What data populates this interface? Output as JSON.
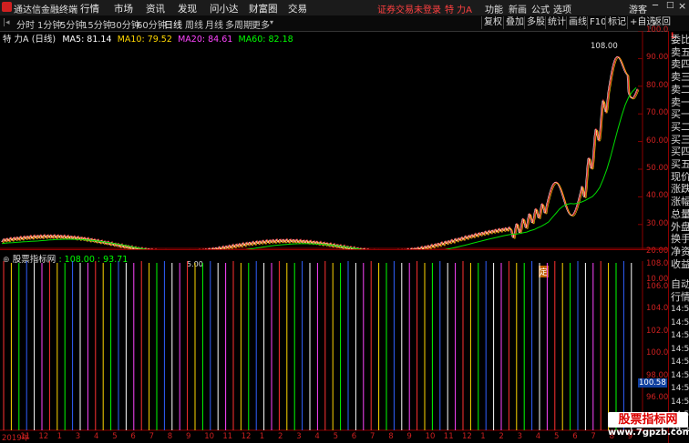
{
  "menubar": {
    "app_title": "通达信金融终端",
    "items": [
      "行情",
      "市场",
      "资讯",
      "发现",
      "问小达",
      "财富圈",
      "交易"
    ],
    "notice": "证券交易未登录",
    "stock_short": "特 力A",
    "right_items": [
      "功能",
      "新画",
      "公式",
      "选项"
    ],
    "user": "游客"
  },
  "periodbar": {
    "tabs": [
      "分时",
      "1分钟",
      "5分钟",
      "15分钟",
      "30分钟",
      "60分钟",
      "日线",
      "周线",
      "月线",
      "多周期",
      "更多"
    ],
    "active_tab": "日线",
    "tools": [
      "复权",
      "叠加",
      "多股",
      "统计",
      "画线",
      "F10",
      "标记",
      "+自选",
      "返回"
    ]
  },
  "main_chart": {
    "title": "特 力A",
    "period_label": "(日线)",
    "ma5_label": "MA5: 81.14",
    "ma10_label": "MA10: 79.52",
    "ma20_label": "MA20: 84.61",
    "ma60_label": "MA60: 82.18",
    "high_label": "108.00",
    "low_label": "5.00",
    "marker_label": "定",
    "y_ticks": [
      "100.0",
      "90.00",
      "80.00",
      "70.00",
      "60.00",
      "50.00",
      "40.00",
      "30.00",
      "20.00",
      "10.00"
    ],
    "colors": {
      "ma5": "#ffffff",
      "ma10": "#ffd700",
      "ma20": "#ff44ff",
      "ma60": "#00ff00"
    }
  },
  "indicator": {
    "name": "股票指标网",
    "values_label": ": 108.00 : 93.71",
    "y_ticks": [
      "108.0",
      "106.0",
      "104.0",
      "102.0",
      "100.0",
      "98.00",
      "96.00"
    ],
    "current_value": "100.58"
  },
  "x_axis": {
    "ticks": [
      "2019年",
      "11",
      "12",
      "1",
      "3",
      "4",
      "5",
      "6",
      "7",
      "8",
      "9",
      "10",
      "11",
      "12",
      "1",
      "2",
      "3",
      "4",
      "5",
      "6",
      "7",
      "8",
      "9",
      "10",
      "11",
      "12",
      "1",
      "2",
      "3",
      "4",
      "5",
      "6",
      "7",
      "8",
      "9"
    ]
  },
  "right_panel": {
    "top_badge": "L",
    "items": [
      "委比",
      "卖五",
      "卖四",
      "卖三",
      "卖二",
      "卖一",
      "买一",
      "买二",
      "买三",
      "买四",
      "买五",
      "现价",
      "涨跌",
      "涨幅",
      "总量",
      "外盘",
      "换手",
      "净资",
      "收益"
    ],
    "bottom_items": [
      "自动",
      "行情"
    ],
    "times": [
      "14:55",
      "14:55",
      "14:55",
      "14:56",
      "14:56",
      "14:56",
      "14:56",
      "14:56",
      "14:56",
      "14:56"
    ]
  },
  "watermark": {
    "line1": "股票指标网",
    "line2": "www.7gpzb.com"
  }
}
